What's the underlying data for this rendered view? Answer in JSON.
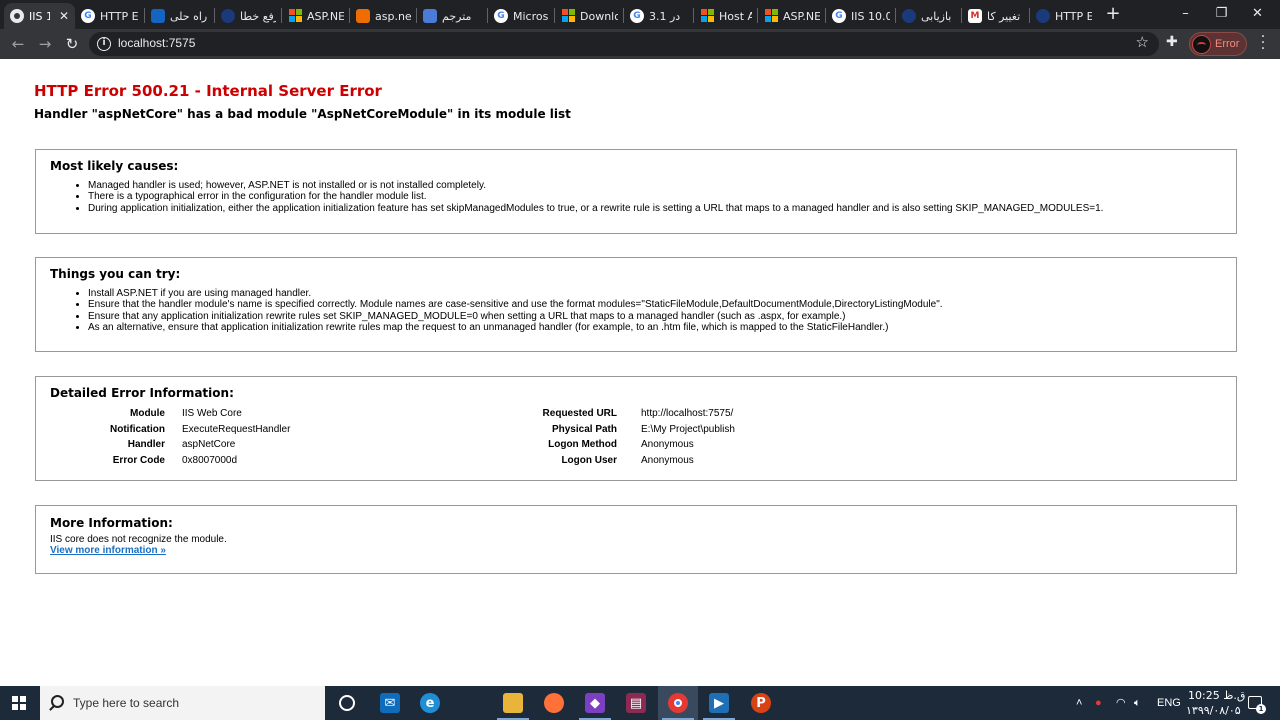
{
  "browser": {
    "tabs": [
      {
        "label": "IIS 1",
        "icon": "globe-icon",
        "active": true
      },
      {
        "label": "HTTP Er",
        "icon": "google-icon"
      },
      {
        "label": "راه حلی",
        "icon": "document-icon"
      },
      {
        "label": "رفع خطا",
        "icon": "website-icon"
      },
      {
        "label": "ASP.NET",
        "icon": "microsoft-icon"
      },
      {
        "label": "asp.net",
        "icon": "stackoverflow-icon"
      },
      {
        "label": "مترجم",
        "icon": "translate-icon"
      },
      {
        "label": "Microsc",
        "icon": "google-icon"
      },
      {
        "label": "Downlo",
        "icon": "microsoft-icon"
      },
      {
        "label": "در 3.1",
        "icon": "google-icon"
      },
      {
        "label": "Host AS",
        "icon": "microsoft-icon"
      },
      {
        "label": "ASP.NE",
        "icon": "microsoft-icon"
      },
      {
        "label": "IIS 10.0",
        "icon": "google-icon"
      },
      {
        "label": "بازیابی",
        "icon": "website-icon"
      },
      {
        "label": "تغییر کا",
        "icon": "gmail-icon"
      },
      {
        "label": "HTTP Er",
        "icon": "website-icon"
      }
    ],
    "tab_close": "✕",
    "new_tab": "+",
    "window_controls": {
      "minimize": "–",
      "maximize": "❐",
      "close": "✕"
    },
    "toolbar": {
      "url": "localhost:7575",
      "profile_label": "Error"
    }
  },
  "page": {
    "title": "HTTP Error 500.21 - Internal Server Error",
    "subtitle": "Handler \"aspNetCore\" has a bad module \"AspNetCoreModule\" in its module list",
    "causes": {
      "heading": "Most likely causes:",
      "items": [
        "Managed handler is used; however, ASP.NET is not installed or is not installed completely.",
        "There is a typographical error in the configuration for the handler module list.",
        "During application initialization, either the application initialization feature has set skipManagedModules to true, or a rewrite rule is setting a URL that maps to a managed handler and is also setting SKIP_MANAGED_MODULES=1."
      ]
    },
    "try": {
      "heading": "Things you can try:",
      "items": [
        "Install ASP.NET if you are using managed handler.",
        "Ensure that the handler module's name is specified correctly. Module names are case-sensitive and use the format modules=\"StaticFileModule,DefaultDocumentModule,DirectoryListingModule\".",
        "Ensure that any application initialization rewrite rules set SKIP_MANAGED_MODULE=0 when setting a URL that maps to a managed handler (such as .aspx, for example.)",
        "As an alternative, ensure that application initialization rewrite rules map the request to an unmanaged handler (for example, to an .htm file, which is mapped to the StaticFileHandler.)"
      ]
    },
    "details": {
      "heading": "Detailed Error Information:",
      "left": [
        {
          "label": "Module",
          "value": "IIS Web Core"
        },
        {
          "label": "Notification",
          "value": "ExecuteRequestHandler"
        },
        {
          "label": "Handler",
          "value": "aspNetCore"
        },
        {
          "label": "Error Code",
          "value": "0x8007000d"
        }
      ],
      "right": [
        {
          "label": "Requested URL",
          "value": "http://localhost:7575/"
        },
        {
          "label": "Physical Path",
          "value": "E:\\My Project\\publish"
        },
        {
          "label": "Logon Method",
          "value": "Anonymous"
        },
        {
          "label": "Logon User",
          "value": "Anonymous"
        }
      ]
    },
    "more": {
      "heading": "More Information:",
      "text": "IIS core does not recognize the module.",
      "link": "View more information »"
    }
  },
  "taskbar": {
    "search_placeholder": "Type here to search",
    "lang": "ENG",
    "time": "10:25 ق.ظ",
    "date": "۱۳۹۹/۰۸/۰۵",
    "notification_count": "1"
  }
}
